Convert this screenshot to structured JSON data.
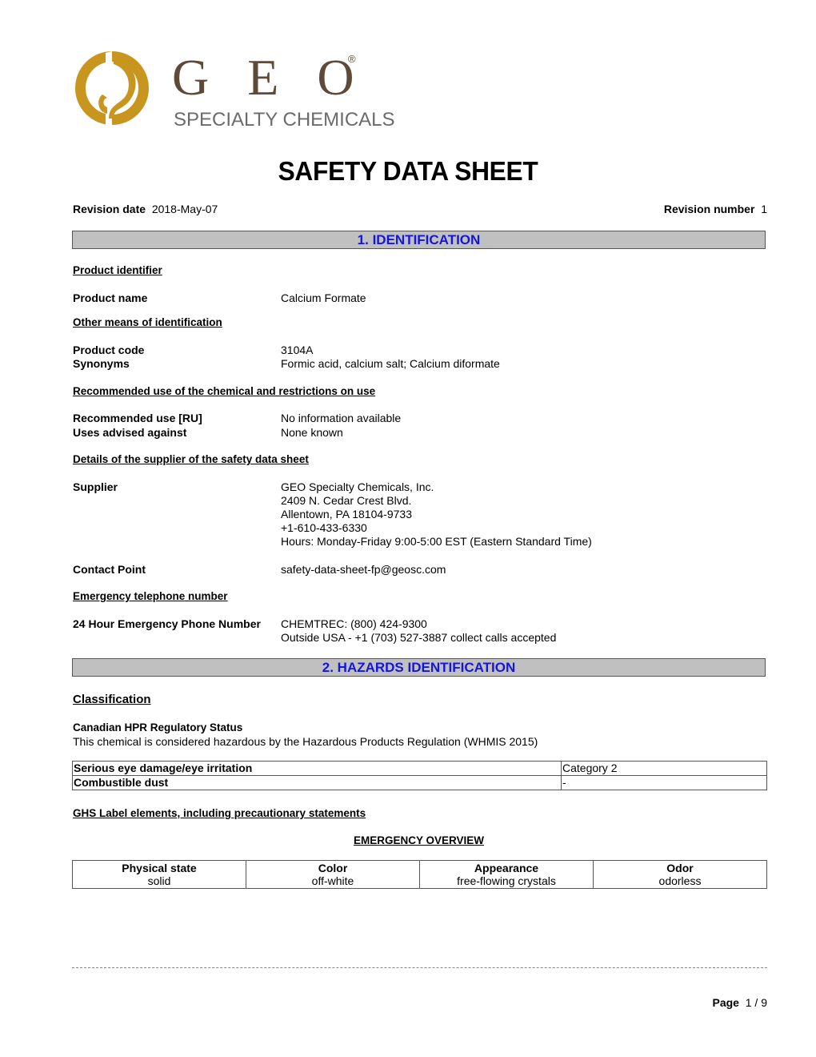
{
  "logo": {
    "brand": "G E O",
    "registered": "®",
    "tagline": "SPECIALTY CHEMICALS",
    "colors": {
      "emblem": "#c8961e",
      "text": "#5e4a38",
      "tagline": "#6b6b6b"
    }
  },
  "title": "SAFETY DATA SHEET",
  "revision": {
    "date_label": "Revision date",
    "date_value": "2018-May-07",
    "number_label": "Revision number",
    "number_value": "1"
  },
  "section1": {
    "heading": "1. IDENTIFICATION",
    "product_identifier": "Product identifier",
    "product_name_label": "Product name",
    "product_name_value": "Calcium Formate",
    "other_means": "Other means of identification",
    "product_code_label": "Product code",
    "product_code_value": "3104A",
    "synonyms_label": "Synonyms",
    "synonyms_value": "Formic acid, calcium salt; Calcium diformate",
    "recommended_use_heading": "Recommended use of the chemical and restrictions on use",
    "recommended_use_label": "Recommended use [RU]",
    "recommended_use_value": "No information available",
    "uses_advised_label": "Uses advised against",
    "uses_advised_value": "None known",
    "supplier_heading": "Details of the supplier of the safety data sheet",
    "supplier_label": "Supplier",
    "supplier_lines": [
      "GEO Specialty Chemicals, Inc.",
      "2409 N. Cedar Crest Blvd.",
      "Allentown, PA 18104-9733",
      "+1-610-433-6330",
      "Hours: Monday-Friday 9:00-5:00 EST (Eastern Standard Time)"
    ],
    "contact_label": "Contact Point",
    "contact_value": "safety-data-sheet-fp@geosc.com",
    "emergency_heading": "Emergency telephone number",
    "emergency_label": "24 Hour Emergency Phone Number",
    "emergency_lines": [
      "CHEMTREC: (800) 424-9300",
      "Outside USA -  +1 (703) 527-3887 collect calls accepted"
    ]
  },
  "section2": {
    "heading": "2. HAZARDS IDENTIFICATION",
    "classification": "Classification",
    "hpr_heading": "Canadian HPR Regulatory Status",
    "hpr_text": "This chemical is considered hazardous by the Hazardous Products Regulation (WHMIS 2015)",
    "hazards": [
      {
        "name": "Serious eye damage/eye irritation",
        "category": "Category 2"
      },
      {
        "name": "Combustible dust",
        "category": "-"
      }
    ],
    "ghs_heading": "GHS Label elements, including precautionary statements",
    "overview_heading": "EMERGENCY OVERVIEW",
    "overview": [
      {
        "label": "Physical state",
        "value": "solid"
      },
      {
        "label": "Color",
        "value": "off-white"
      },
      {
        "label": "Appearance",
        "value": "free-flowing crystals"
      },
      {
        "label": "Odor",
        "value": "odorless"
      }
    ]
  },
  "footer": {
    "page_label": "Page",
    "page_value": "1 / 9"
  }
}
